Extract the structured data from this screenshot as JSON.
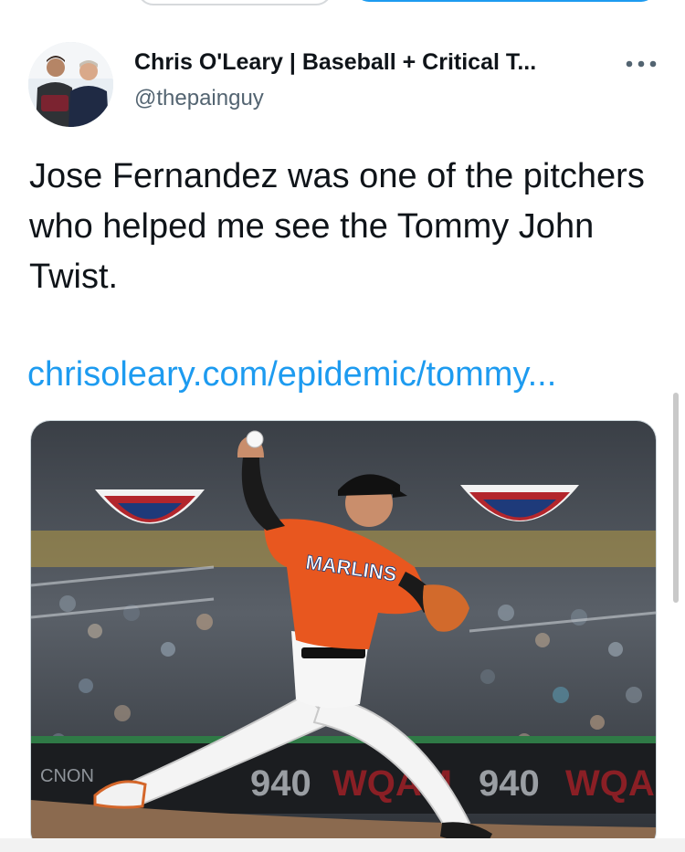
{
  "tweet": {
    "author_name": "Chris O'Leary | Baseball + Critical T...",
    "author_handle": "@thepainguy",
    "text": "Jose Fernandez was one of the pitchers who helped me see the Tommy John Twist.",
    "link": "chrisoleary.com/epidemic/tommy...",
    "more_icon": "more-horizontal-icon"
  },
  "media": {
    "jersey_text": "MARLINS",
    "board_text_1": "940",
    "board_text_2": "WQAM",
    "board_text_3": "940",
    "board_text_4": "WQAM",
    "board_text_5": "CNON"
  },
  "colors": {
    "link": "#1d9bf0",
    "jersey": "#e8571f",
    "name": "#0f1419",
    "handle": "#536471"
  }
}
